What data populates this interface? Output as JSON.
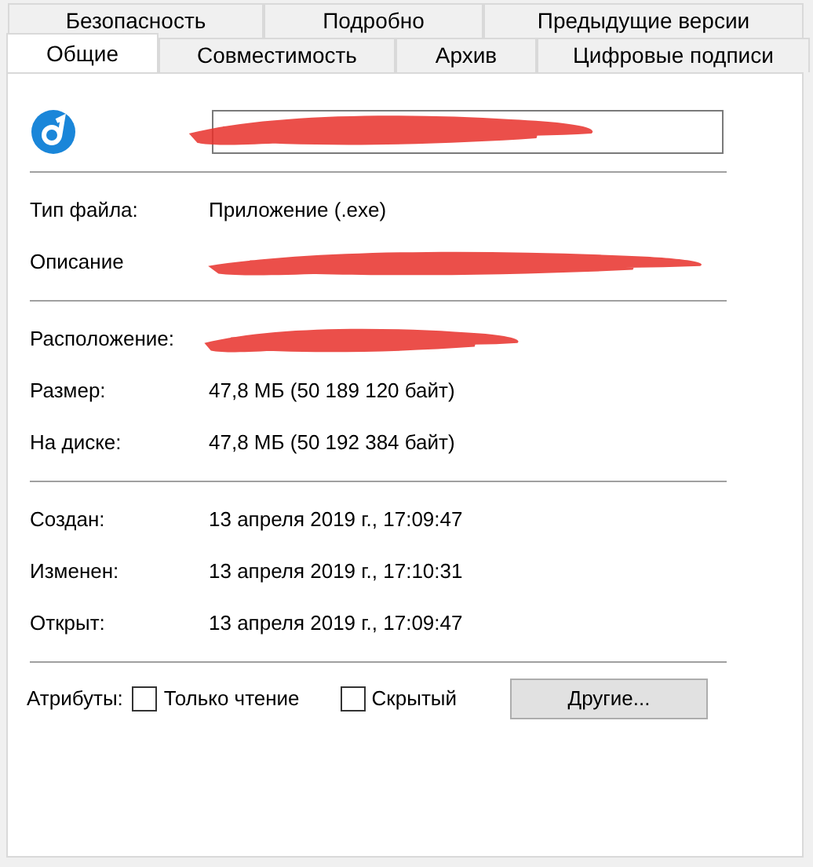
{
  "tab_rows": [
    {
      "tabs": [
        {
          "label": "Безопасность",
          "selected": false
        },
        {
          "label": "Подробно",
          "selected": false
        },
        {
          "label": "Предыдущие версии",
          "selected": false
        }
      ]
    },
    {
      "tabs": [
        {
          "label": "Общие",
          "selected": true
        },
        {
          "label": "Совместимость",
          "selected": false
        },
        {
          "label": "Архив",
          "selected": false
        },
        {
          "label": "Цифровые подписи",
          "selected": false
        }
      ]
    }
  ],
  "groups": [
    [
      {
        "label": "Тип файла:",
        "value": "Приложение (.exe)"
      },
      {
        "label": "Описание",
        "redacted": true
      }
    ],
    [
      {
        "label": "Расположение:",
        "redacted": true
      },
      {
        "label": "Размер:",
        "value": "47,8 МБ (50 189 120 байт)"
      },
      {
        "label": "На диске:",
        "value": "47,8 МБ (50 192 384 байт)"
      }
    ],
    [
      {
        "label": "Создан:",
        "value": "13 апреля 2019 г., 17:09:47"
      },
      {
        "label": "Изменен:",
        "value": "13 апреля 2019 г., 17:10:31"
      },
      {
        "label": "Открыт:",
        "value": "13 апреля 2019 г., 17:09:47"
      }
    ]
  ],
  "attributes": {
    "label": "Атрибуты:",
    "checkboxes": [
      {
        "label": "Только чтение",
        "checked": false
      },
      {
        "label": "Скрытый",
        "checked": false
      }
    ],
    "button": "Другие..."
  }
}
